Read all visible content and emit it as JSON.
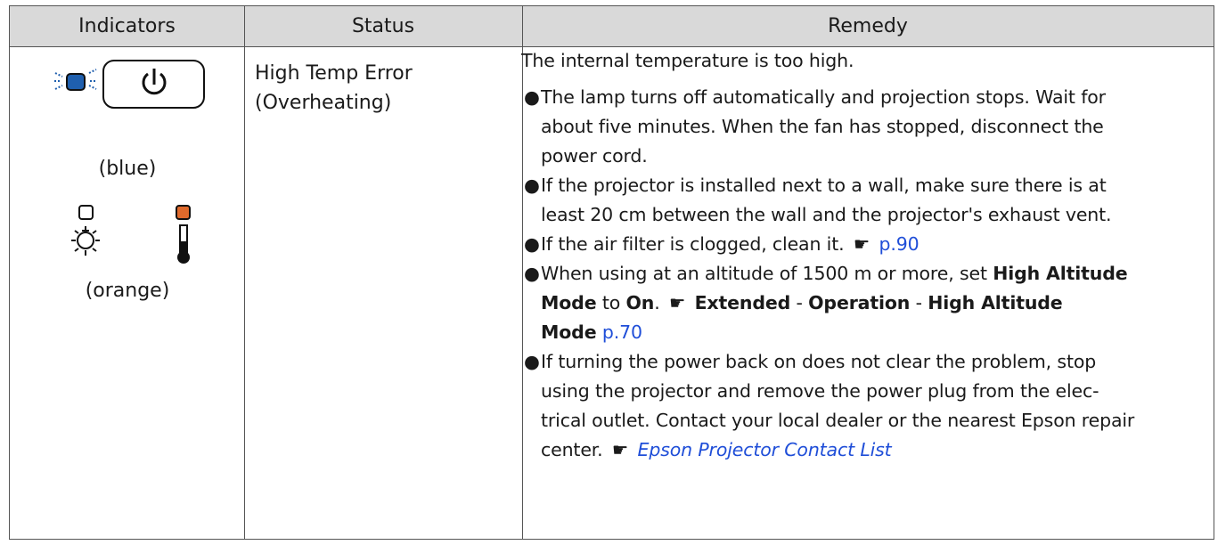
{
  "table": {
    "headers": [
      "Indicators",
      "Status",
      "Remedy"
    ]
  },
  "indicators": {
    "power_color_label": "(blue)",
    "warning_color_label": "(orange)",
    "icons": [
      "power-button-icon",
      "lamp-icon",
      "temperature-icon"
    ],
    "colors": {
      "blue": "#1f5fae",
      "orange": "#e06a2c"
    }
  },
  "status": {
    "line1": "High Temp Error",
    "line2": "(Overheating)"
  },
  "remedy": {
    "intro": "The internal temperature is too high.",
    "b1_l1": "The lamp turns off automatically and projection stops. Wait for",
    "b1_l2": "about five minutes. When the fan has stopped, disconnect the",
    "b1_l3": "power cord.",
    "b2_l1": "If the projector is installed next to a wall, make sure there is at",
    "b2_l2": "least 20 cm between the wall and the projector's exhaust vent.",
    "b3_text": "If the air filter is clogged, clean it.",
    "b3_link": "p.90",
    "b4_l1_text": "When using at an altitude of 1500 m or more, set ",
    "b4_l1_bold": "High Altitude",
    "b4_l2_bold1": "Mode",
    "b4_l2_to": " to ",
    "b4_l2_on": "On",
    "b4_l2_dot": ".",
    "b4_l2_ext": "Extended",
    "b4_l2_dash1": " - ",
    "b4_l2_op": "Operation",
    "b4_l2_dash2": " - ",
    "b4_l2_ha": "High Altitude",
    "b4_l3_mode": "Mode",
    "b4_l3_link": "p.70",
    "b5_l1": "If turning the power back on does not clear the problem, stop",
    "b5_l2": "using the projector and remove the power plug from the elec-",
    "b5_l3": "trical outlet. Contact your local dealer or the nearest Epson repair",
    "b5_l4_text": "center.",
    "b5_l4_link": "Epson Projector Contact List"
  }
}
